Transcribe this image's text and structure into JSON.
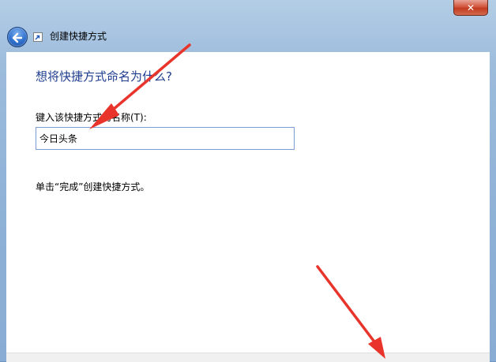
{
  "window": {
    "title": "创建快捷方式",
    "close_glyph": "✕"
  },
  "page": {
    "heading": "想将快捷方式命名为什么?",
    "field_label": "键入该快捷方式的名称(T):",
    "field_value": "今日头条",
    "hint": "单击“完成”创建快捷方式。"
  },
  "colors": {
    "heading": "#1e3d8f",
    "annotation_arrow": "#e8342a"
  },
  "icons": [
    "close-icon",
    "back-arrow-icon",
    "shortcut-icon"
  ]
}
